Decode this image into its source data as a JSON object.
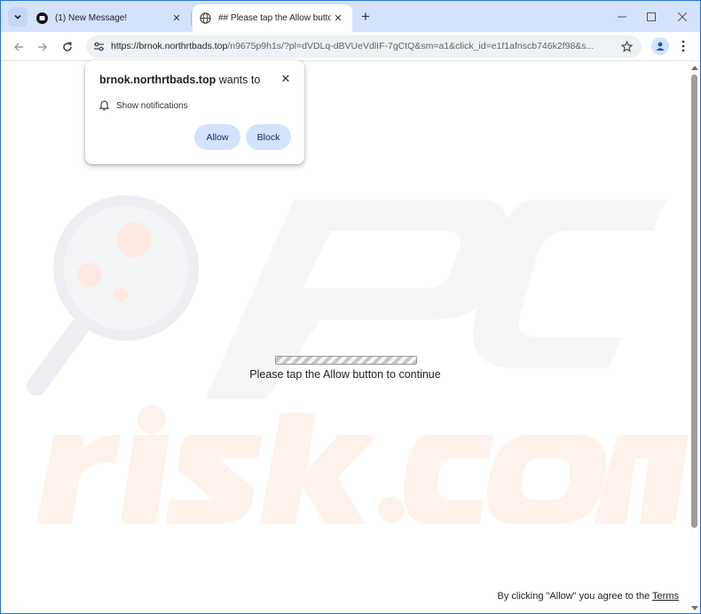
{
  "browser": {
    "tabs": [
      {
        "title": "(1) New Message!",
        "active": false,
        "favicon": "message-icon"
      },
      {
        "title": "## Please tap the Allow button",
        "active": true,
        "favicon": "globe-icon"
      }
    ],
    "address_bar": {
      "url_host": "https://brnok.northrtbads.top",
      "url_rest": "/n9675p9h1s/?pl=dVDLq-dBVUeVdlIF-7gCtQ&sm=a1&click_id=e1f1afnscb746k2f98&s..."
    }
  },
  "permission_popup": {
    "site": "brnok.northrtbads.top",
    "suffix": " wants to",
    "permission": "Show notifications",
    "allow_label": "Allow",
    "block_label": "Block"
  },
  "page": {
    "progress_fraction": 1.0,
    "message": "Please tap the Allow button to continue",
    "footer_prefix": "By clicking \"Allow\" you agree to the ",
    "footer_link": "Terms"
  },
  "colors": {
    "tabstrip": "#d3e3fd",
    "button": "#d3e3fd",
    "border": "#2b6fd1"
  }
}
